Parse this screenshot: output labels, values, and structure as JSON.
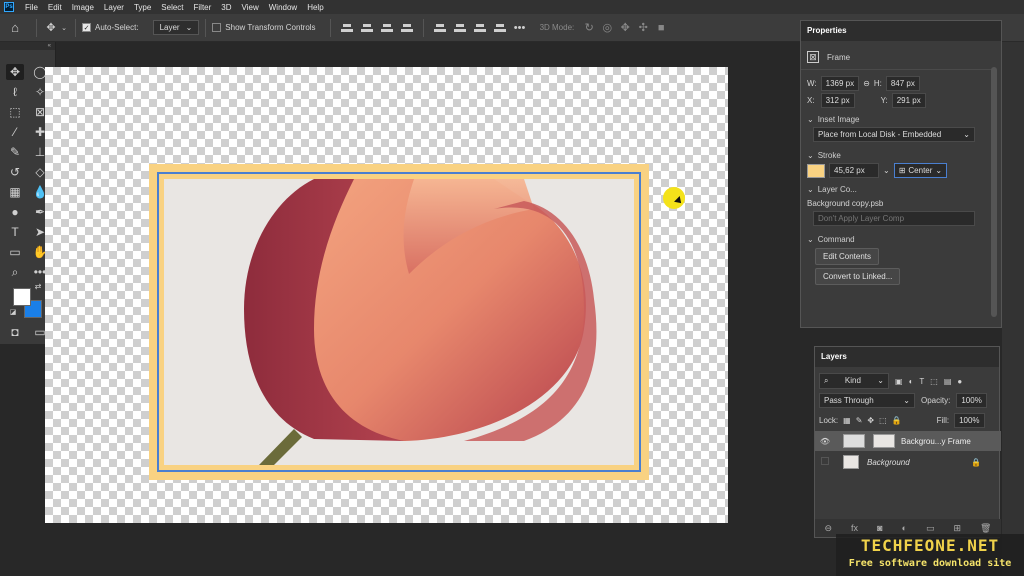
{
  "menubar": {
    "logo": "Ps",
    "items": [
      "File",
      "Edit",
      "Image",
      "Layer",
      "Type",
      "Select",
      "Filter",
      "3D",
      "View",
      "Window",
      "Help"
    ]
  },
  "options_bar": {
    "auto_select_label": "Auto-Select:",
    "auto_select_checked": true,
    "auto_select_target": "Layer",
    "show_transform_label": "Show Transform Controls",
    "show_transform_checked": false,
    "three_d_mode_label": "3D Mode:"
  },
  "tools": {
    "foreground_color": "#ffffff",
    "background_color": "#1a7fe8"
  },
  "canvas": {
    "frame_fill_color": "#f9d282",
    "frame_stroke_color": "#4a7fd0"
  },
  "properties": {
    "title": "Properties",
    "type_label": "Frame",
    "w_label": "W:",
    "w_value": "1369 px",
    "h_label": "H:",
    "h_value": "847 px",
    "x_label": "X:",
    "x_value": "312 px",
    "y_label": "Y:",
    "y_value": "291 px",
    "inset_image_label": "Inset Image",
    "inset_image_option": "Place from Local Disk - Embedded",
    "stroke_label": "Stroke",
    "stroke_width": "45,62 px",
    "stroke_position": "Center",
    "layer_comp_label": "Layer Co...",
    "layer_comp_file": "Background copy.psb",
    "layer_comp_option": "Don't Apply Layer Comp",
    "command_label": "Command",
    "edit_contents_button": "Edit Contents",
    "convert_button": "Convert to Linked..."
  },
  "layers": {
    "title": "Layers",
    "filter_kind": "Kind",
    "blend_mode": "Pass Through",
    "opacity_label": "Opacity:",
    "opacity_value": "100%",
    "lock_label": "Lock:",
    "fill_label": "Fill:",
    "fill_value": "100%",
    "items": [
      {
        "name": "Backgrou...y Frame",
        "visible": true,
        "selected": true
      },
      {
        "name": "Background",
        "visible": false,
        "selected": false
      }
    ]
  },
  "watermark": {
    "title": "TECHFEONE.NET",
    "subtitle": "Free software download site"
  }
}
